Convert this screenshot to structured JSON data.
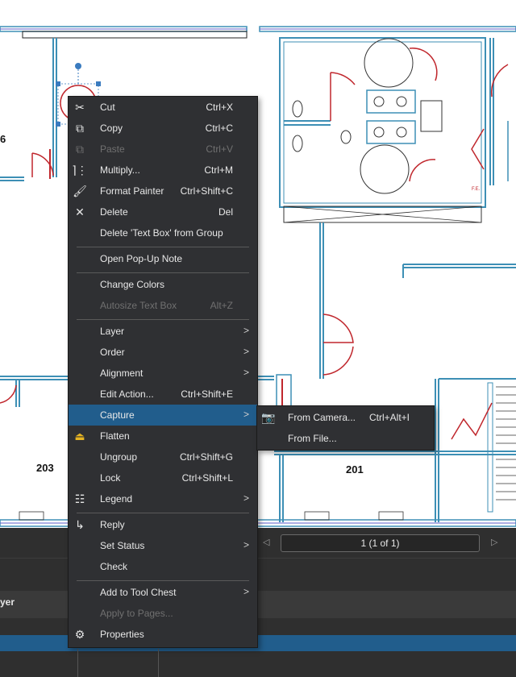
{
  "drawing": {
    "room_labels": [
      "6",
      "203",
      "201"
    ],
    "small_label": "F.E."
  },
  "bottom_bar": {
    "page_indicator": "1 (1 of 1)",
    "column_header": "yer"
  },
  "context_menu": {
    "items": [
      {
        "label": "Cut",
        "shortcut": "Ctrl+X",
        "icon": "scissors-icon",
        "enabled": true
      },
      {
        "label": "Copy",
        "shortcut": "Ctrl+C",
        "icon": "copy-icon",
        "enabled": true
      },
      {
        "label": "Paste",
        "shortcut": "Ctrl+V",
        "icon": "paste-icon",
        "enabled": false
      },
      {
        "label": "Multiply...",
        "shortcut": "Ctrl+M",
        "icon": "multiply-icon",
        "enabled": true
      },
      {
        "label": "Format Painter",
        "shortcut": "Ctrl+Shift+C",
        "icon": "paintbrush-icon",
        "enabled": true
      },
      {
        "label": "Delete",
        "shortcut": "Del",
        "icon": "close-icon",
        "enabled": true
      },
      {
        "label": "Delete 'Text Box' from Group",
        "shortcut": "",
        "enabled": true
      },
      {
        "label": "Open Pop-Up Note",
        "shortcut": "",
        "enabled": true
      },
      {
        "label": "Change Colors",
        "shortcut": "",
        "enabled": true
      },
      {
        "label": "Autosize Text Box",
        "shortcut": "Alt+Z",
        "enabled": false
      },
      {
        "label": "Layer",
        "shortcut": "",
        "submenu": true,
        "enabled": true
      },
      {
        "label": "Order",
        "shortcut": "",
        "submenu": true,
        "enabled": true
      },
      {
        "label": "Alignment",
        "shortcut": "",
        "submenu": true,
        "enabled": true
      },
      {
        "label": "Edit Action...",
        "shortcut": "Ctrl+Shift+E",
        "enabled": true
      },
      {
        "label": "Capture",
        "shortcut": "",
        "submenu": true,
        "enabled": true,
        "highlighted": true
      },
      {
        "label": "Flatten",
        "shortcut": "",
        "icon": "flatten-icon",
        "enabled": true
      },
      {
        "label": "Ungroup",
        "shortcut": "Ctrl+Shift+G",
        "enabled": true
      },
      {
        "label": "Lock",
        "shortcut": "Ctrl+Shift+L",
        "enabled": true
      },
      {
        "label": "Legend",
        "shortcut": "",
        "icon": "legend-icon",
        "submenu": true,
        "enabled": true
      },
      {
        "label": "Reply",
        "shortcut": "",
        "icon": "reply-icon",
        "enabled": true
      },
      {
        "label": "Set Status",
        "shortcut": "",
        "submenu": true,
        "enabled": true
      },
      {
        "label": "Check",
        "shortcut": "",
        "enabled": true
      },
      {
        "label": "Add to Tool Chest",
        "shortcut": "",
        "submenu": true,
        "enabled": true
      },
      {
        "label": "Apply to Pages...",
        "shortcut": "",
        "enabled": false
      },
      {
        "label": "Properties",
        "shortcut": "",
        "icon": "gear-icon",
        "enabled": true
      }
    ]
  },
  "capture_submenu": {
    "items": [
      {
        "label": "From Camera...",
        "shortcut": "Ctrl+Alt+I",
        "icon": "camera-icon"
      },
      {
        "label": "From File...",
        "shortcut": ""
      }
    ]
  },
  "colors": {
    "menu_bg": "#2f3033",
    "highlight": "#215d8c",
    "wall_cyan": "#3d8fb5",
    "door_red": "#c0272d"
  }
}
